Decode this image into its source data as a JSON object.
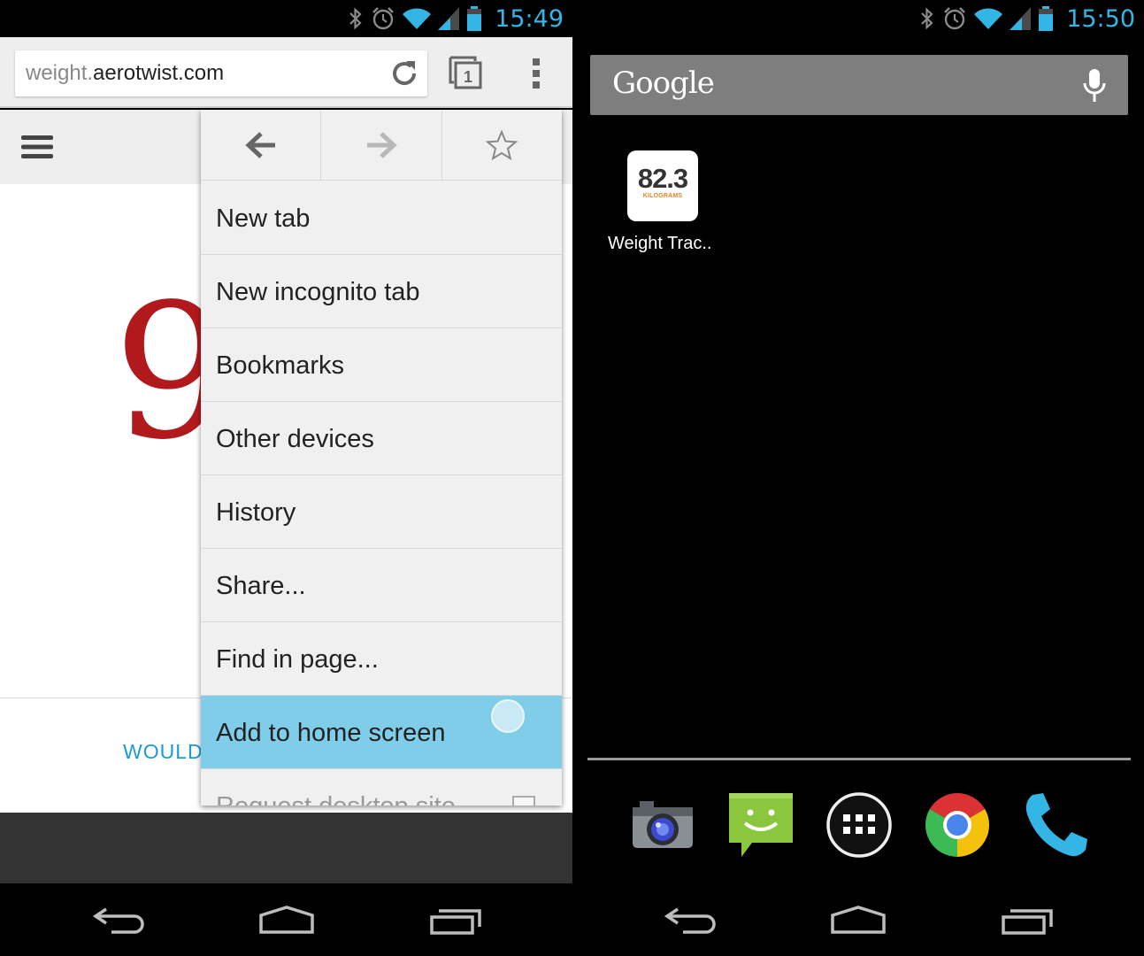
{
  "left_screen": {
    "status": {
      "time": "15:49"
    },
    "omnibox": {
      "url_subdomain": "weight.",
      "url_domain": "aerotwist.com",
      "tab_count": "1"
    },
    "page": {
      "big_digit": "9",
      "teaser_text": "WOULD"
    },
    "menu": {
      "items": [
        {
          "label": "New tab"
        },
        {
          "label": "New incognito tab"
        },
        {
          "label": "Bookmarks"
        },
        {
          "label": "Other devices"
        },
        {
          "label": "History"
        },
        {
          "label": "Share..."
        },
        {
          "label": "Find in page..."
        },
        {
          "label": "Add to home screen",
          "highlighted": true
        },
        {
          "label": "Request desktop site",
          "checkbox": false
        }
      ]
    }
  },
  "right_screen": {
    "status": {
      "time": "15:50"
    },
    "search": {
      "logo_text": "Google"
    },
    "app_shortcut": {
      "value": "82.3",
      "unit": "KILOGRAMS",
      "label": "Weight Trac.."
    },
    "dock": [
      "camera-icon",
      "messaging-icon",
      "app-drawer-icon",
      "chrome-icon",
      "phone-icon"
    ]
  },
  "colors": {
    "accent": "#33b5e5",
    "menu_highlight": "#7fcde8",
    "digit_red": "#b2191d",
    "link_blue": "#1e9ccf"
  }
}
